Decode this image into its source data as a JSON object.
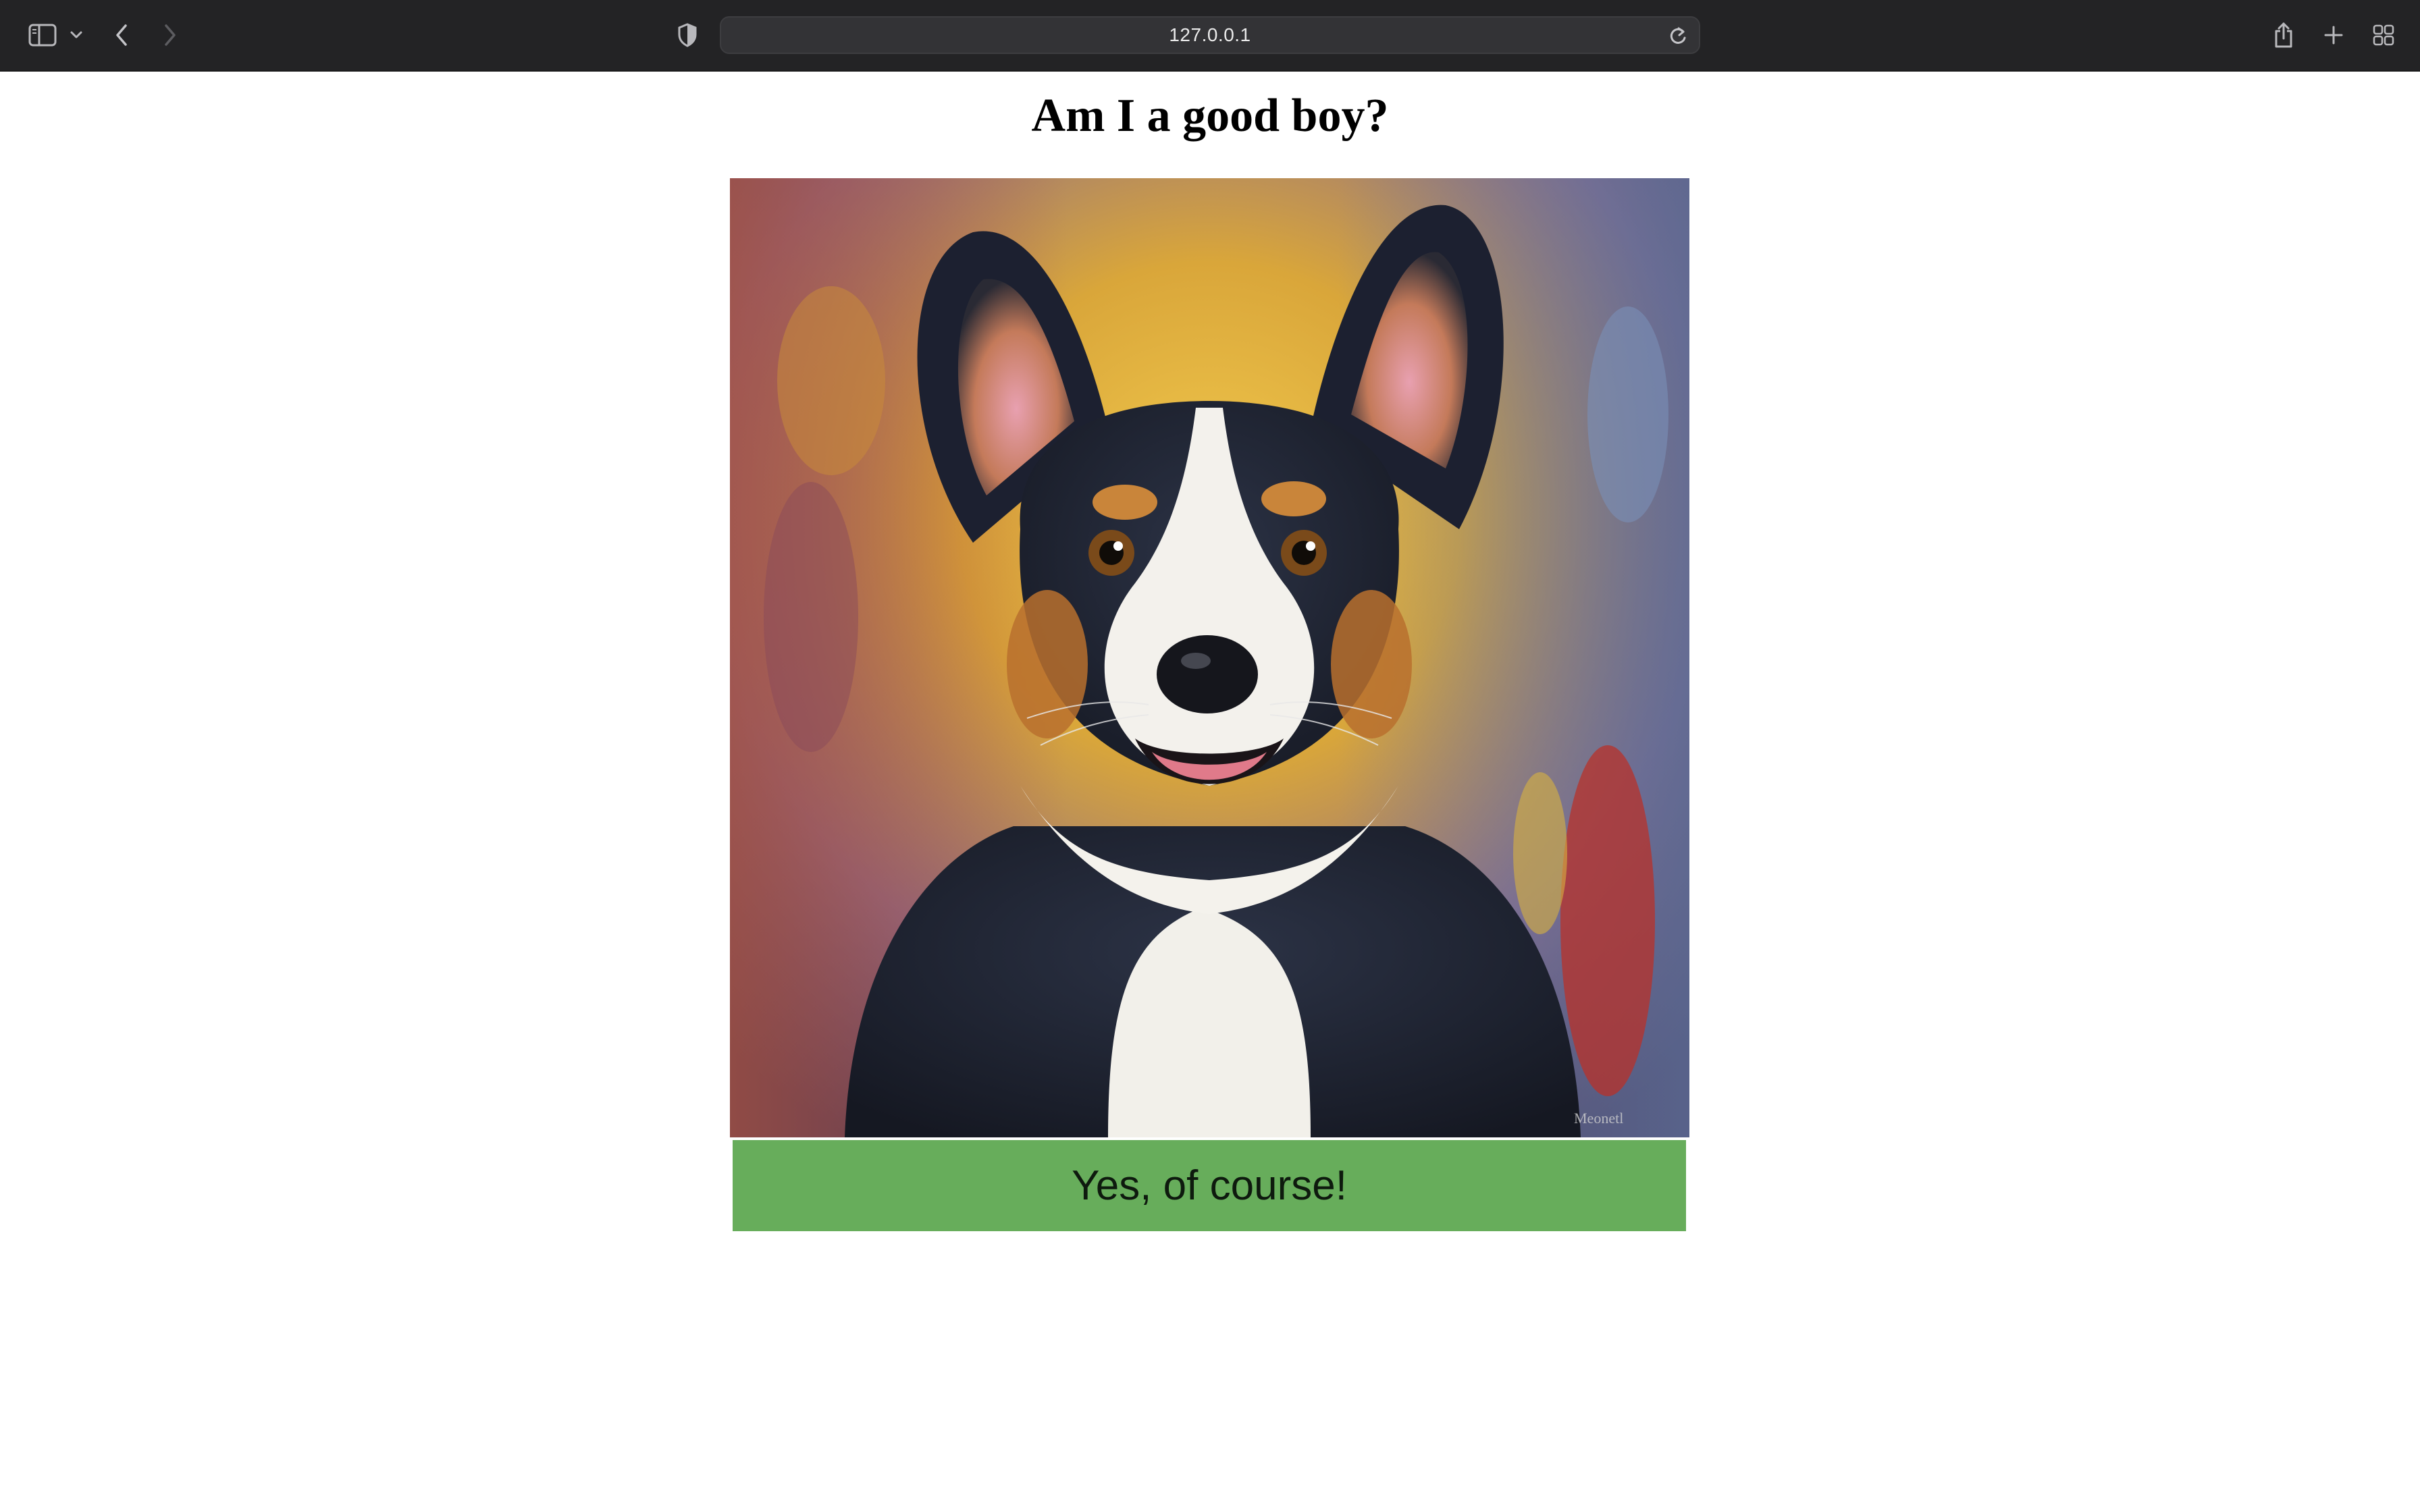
{
  "browser": {
    "url": "127.0.0.1",
    "icons": {
      "sidebar": "sidebar-icon",
      "sidebar_menu": "chevron-down-icon",
      "back": "back-arrow-icon",
      "forward": "forward-arrow-icon",
      "privacy": "shield-icon",
      "reload": "reload-icon",
      "share": "share-icon",
      "new_tab": "plus-icon",
      "tab_overview": "tab-grid-icon"
    }
  },
  "page": {
    "title": "Am I a good boy?",
    "image": {
      "subject": "painted portrait of a tricolor corgi",
      "watermark": "Meonetl"
    },
    "answer_button": {
      "label": "Yes, of course!",
      "color": "#67ad5b"
    }
  }
}
